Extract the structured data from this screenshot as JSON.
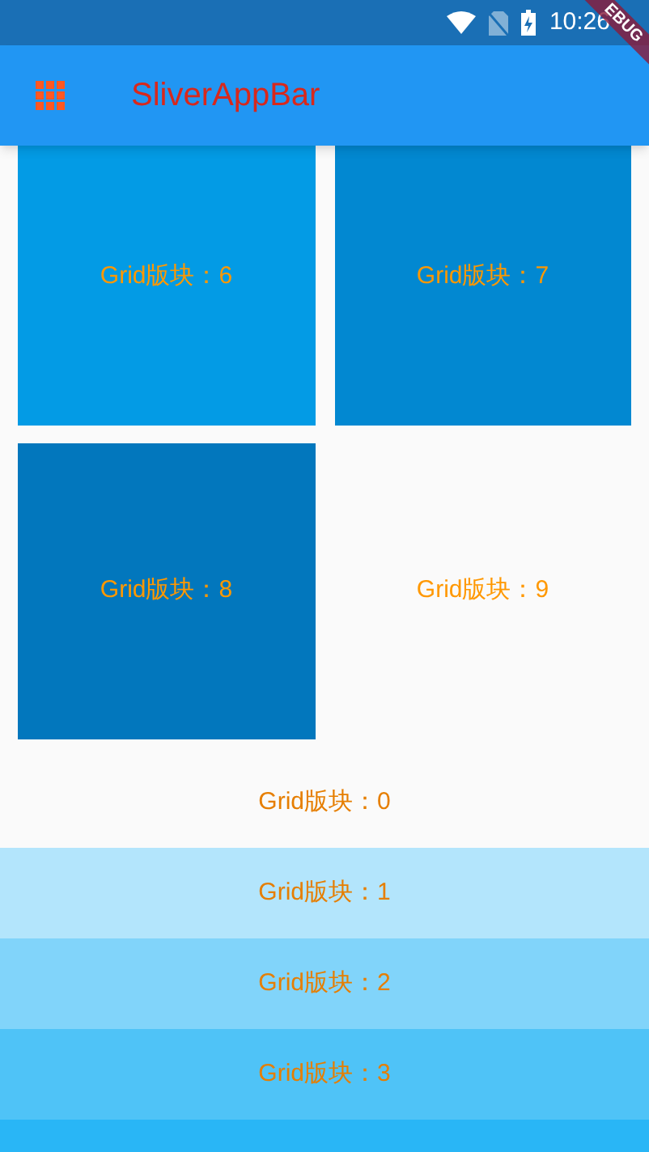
{
  "status_bar": {
    "time": "10:26"
  },
  "debug_banner": {
    "label": "EBUG"
  },
  "app_bar": {
    "title": "SliverAppBar"
  },
  "grid": [
    {
      "label": "Grid版块：6",
      "color": "#039be5"
    },
    {
      "label": "Grid版块：7",
      "color": "#0288d1"
    },
    {
      "label": "Grid版块：8",
      "color": "#0277bd"
    },
    {
      "label": "Grid版块：9",
      "color": "#fafafa"
    }
  ],
  "list": [
    {
      "label": "Grid版块：0",
      "color": "#fafafa"
    },
    {
      "label": "Grid版块：1",
      "color": "#b3e5fc"
    },
    {
      "label": "Grid版块：2",
      "color": "#81d4fa"
    },
    {
      "label": "Grid版块：3",
      "color": "#4fc3f7"
    },
    {
      "color": "#29b6f6"
    }
  ]
}
